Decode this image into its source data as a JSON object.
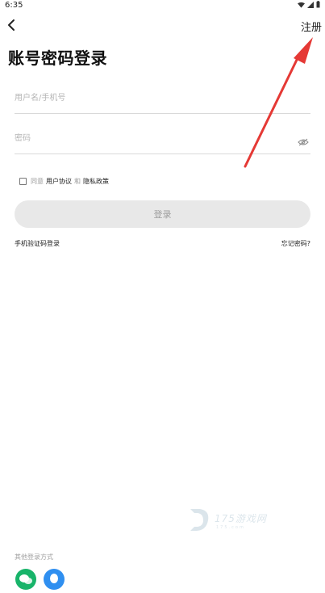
{
  "status_bar": {
    "time": "6:35"
  },
  "header": {
    "back_icon": "chevron-left-icon",
    "register_label": "注册"
  },
  "page": {
    "title": "账号密码登录"
  },
  "form": {
    "username_placeholder": "用户名/手机号",
    "password_placeholder": "密码",
    "eye_icon": "eye-off-icon"
  },
  "agreement": {
    "agree_text": "同意",
    "user_agreement": "用户协议",
    "and_text": "和",
    "privacy_policy": "隐私政策"
  },
  "actions": {
    "login_label": "登录",
    "sms_login_label": "手机验证码登录",
    "forgot_password_label": "忘记密码?"
  },
  "other_login": {
    "label": "其他登录方式",
    "icons": [
      "wechat-icon",
      "qq-icon"
    ]
  },
  "watermark": {
    "text": "175游戏网",
    "subtext": "175.com"
  },
  "colors": {
    "annotation_red": "#e53935",
    "login_button_bg": "#e8e8e8",
    "wechat": "#18b46a",
    "qq": "#2f8ff0"
  }
}
